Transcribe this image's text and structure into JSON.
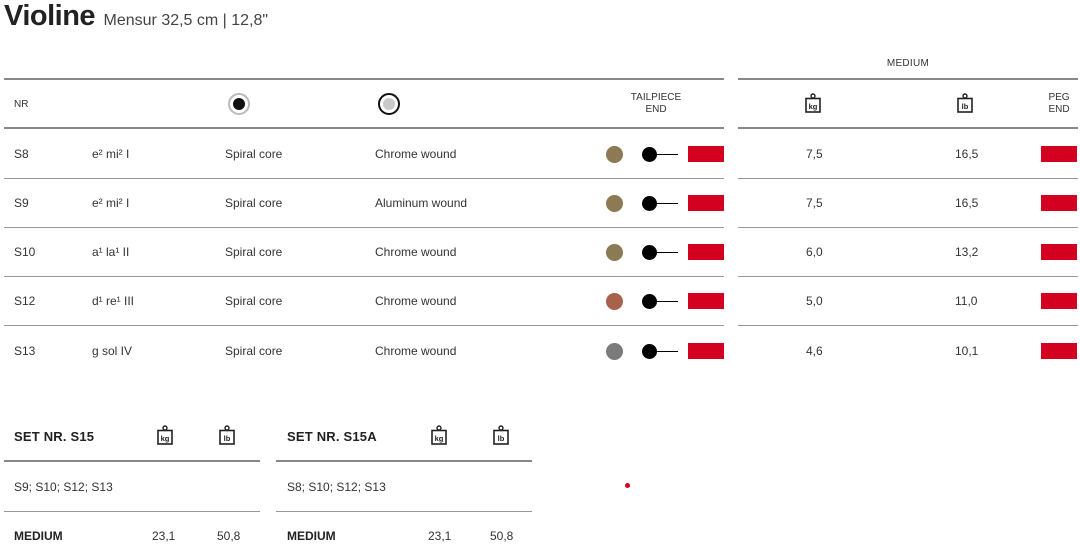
{
  "title": {
    "main": "Violine",
    "sub": "Mensur 32,5 cm | 12,8\""
  },
  "header": {
    "nr": "NR",
    "medium": "MEDIUM",
    "tailpiece": [
      "TAILPIECE",
      "END"
    ],
    "peg": [
      "PEG",
      "END"
    ],
    "icons": {
      "core": "core-material-icon",
      "winding": "winding-material-icon",
      "kg": "kg",
      "lb": "lb"
    }
  },
  "rows": [
    {
      "nr": "S8",
      "note": "e² mi² I",
      "core": "Spiral core",
      "winding": "Chrome wound",
      "dot_color": "#8c7a55",
      "kg": "7,5",
      "lb": "16,5"
    },
    {
      "nr": "S9",
      "note": "e² mi² I",
      "core": "Spiral core",
      "winding": "Aluminum wound",
      "dot_color": "#8c7a55",
      "kg": "7,5",
      "lb": "16,5"
    },
    {
      "nr": "S10",
      "note": "a¹ la¹ II",
      "core": "Spiral core",
      "winding": "Chrome wound",
      "dot_color": "#8c7a55",
      "kg": "6,0",
      "lb": "13,2"
    },
    {
      "nr": "S12",
      "note": "d¹ re¹ III",
      "core": "Spiral core",
      "winding": "Chrome wound",
      "dot_color": "#a8614a",
      "kg": "5,0",
      "lb": "11,0"
    },
    {
      "nr": "S13",
      "note": "g sol IV",
      "core": "Spiral core",
      "winding": "Chrome wound",
      "dot_color": "#7b7b7b",
      "kg": "4,6",
      "lb": "10,1"
    }
  ],
  "colors": {
    "flag": "#d4001f"
  },
  "sets": [
    {
      "title": "SET NR. S15",
      "strings": "S9; S10; S12; S13",
      "tension_label": "MEDIUM",
      "kg": "23,1",
      "lb": "50,8"
    },
    {
      "title": "SET NR. S15A",
      "strings": "S8; S10; S12; S13",
      "tension_label": "MEDIUM",
      "kg": "23,1",
      "lb": "50,8"
    }
  ]
}
